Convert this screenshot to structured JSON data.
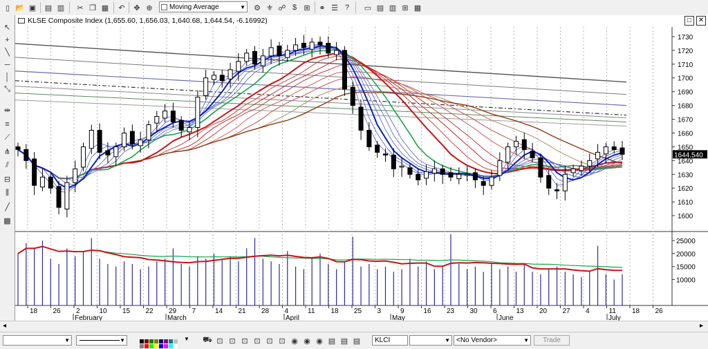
{
  "toolbar": {
    "indicator_select": "Moving Average",
    "icons": [
      "new-icon",
      "open-icon",
      "save-icon",
      "print-preview-icon",
      "cut-icon",
      "copy-icon",
      "paste-icon",
      "undo-icon",
      "crosshair-icon",
      "zoom-icon",
      "indicator-icon",
      "expert-icon",
      "trade-icon",
      "binoculars-icon",
      "options-icon",
      "help-icon",
      "layout-icon",
      "split-h-icon",
      "split-v-icon",
      "tile-icon",
      "cascade-icon"
    ]
  },
  "left_toolbar": {
    "icons": [
      "pointer-icon",
      "crosshair-tool-icon",
      "trendline-icon",
      "horizontal-line-icon",
      "vertical-line-icon",
      "fibonacci-icon",
      "cycle-lines-icon",
      "gann-fan-icon",
      "speed-lines-icon",
      "andrews-pitchfork-icon",
      "regression-channel-icon",
      "tirone-icon",
      "raff-icon",
      "grid-icon"
    ]
  },
  "chart_window": {
    "title": "KLSE Composite Index (1,655.60, 1,656.03, 1,640.68, 1,644.54, -6.16992)",
    "last_price_label": "1644.540",
    "window_buttons": [
      "□",
      "✕"
    ]
  },
  "chart_data": {
    "type": "candlestick",
    "title": "KLSE Composite Index (1,655.60, 1,656.03, 1,640.68, 1,644.54, -6.16992)",
    "last_close": 1644.54,
    "price_axis": {
      "ticks": [
        1600,
        1610,
        1620,
        1630,
        1640,
        1650,
        1660,
        1670,
        1680,
        1690,
        1700,
        1710,
        1720,
        1730
      ],
      "range": [
        1590,
        1737
      ]
    },
    "volume_axis": {
      "ticks": [
        10000,
        15000,
        20000,
        25000
      ],
      "range": [
        0,
        28500
      ]
    },
    "date_axis": {
      "day_ticks": [
        "18",
        "26",
        "2",
        "10",
        "15",
        "22",
        "29",
        "7",
        "14",
        "21",
        "28",
        "4",
        "11",
        "18",
        "25",
        "3",
        "9",
        "16",
        "23",
        "30",
        "6",
        "13",
        "20",
        "27",
        "4",
        "11",
        "18",
        "26"
      ],
      "month_labels": [
        "February",
        "March",
        "April",
        "May",
        "June",
        "July"
      ]
    },
    "closes": [
      1648,
      1640,
      1622,
      1628,
      1620,
      1606,
      1624,
      1634,
      1650,
      1662,
      1646,
      1644,
      1650,
      1660,
      1652,
      1655,
      1666,
      1672,
      1676,
      1668,
      1662,
      1664,
      1686,
      1700,
      1702,
      1698,
      1706,
      1712,
      1718,
      1710,
      1716,
      1722,
      1716,
      1720,
      1724,
      1722,
      1726,
      1724,
      1718,
      1720,
      1692,
      1680,
      1662,
      1650,
      1646,
      1644,
      1634,
      1636,
      1630,
      1626,
      1632,
      1634,
      1630,
      1628,
      1630,
      1630,
      1626,
      1622,
      1628,
      1640,
      1650,
      1654,
      1648,
      1642,
      1628,
      1620,
      1618,
      1630,
      1634,
      1636,
      1640,
      1646,
      1650,
      1648,
      1644.54
    ],
    "volumes": [
      20000,
      24000,
      22000,
      25000,
      18000,
      16000,
      22000,
      19000,
      21000,
      26000,
      18000,
      16000,
      15000,
      17000,
      16000,
      14000,
      15000,
      17000,
      18000,
      22000,
      16000,
      15000,
      19000,
      18000,
      20000,
      18000,
      19000,
      17000,
      22000,
      26000,
      18000,
      17000,
      16000,
      21000,
      15000,
      14000,
      18000,
      20000,
      16000,
      14000,
      17000,
      26500,
      15000,
      16000,
      14000,
      15000,
      13000,
      14000,
      18000,
      15000,
      17000,
      14000,
      15000,
      27500,
      16000,
      14000,
      15000,
      13000,
      16000,
      14000,
      15000,
      13000,
      16000,
      13000,
      12000,
      14000,
      15000,
      13000,
      12000,
      11000,
      13000,
      23000,
      12000,
      10000,
      12000
    ],
    "ma_ribbon_colors": {
      "fast": "#0a1fc8",
      "green": "#17a34a",
      "red": "#c81414",
      "brown": "#8b3a0f",
      "gray": "#7f7f7f"
    }
  },
  "bottom_bar": {
    "symbol": "KLCI",
    "vendor": "<No Vendor>",
    "trade_button": "Trade"
  }
}
